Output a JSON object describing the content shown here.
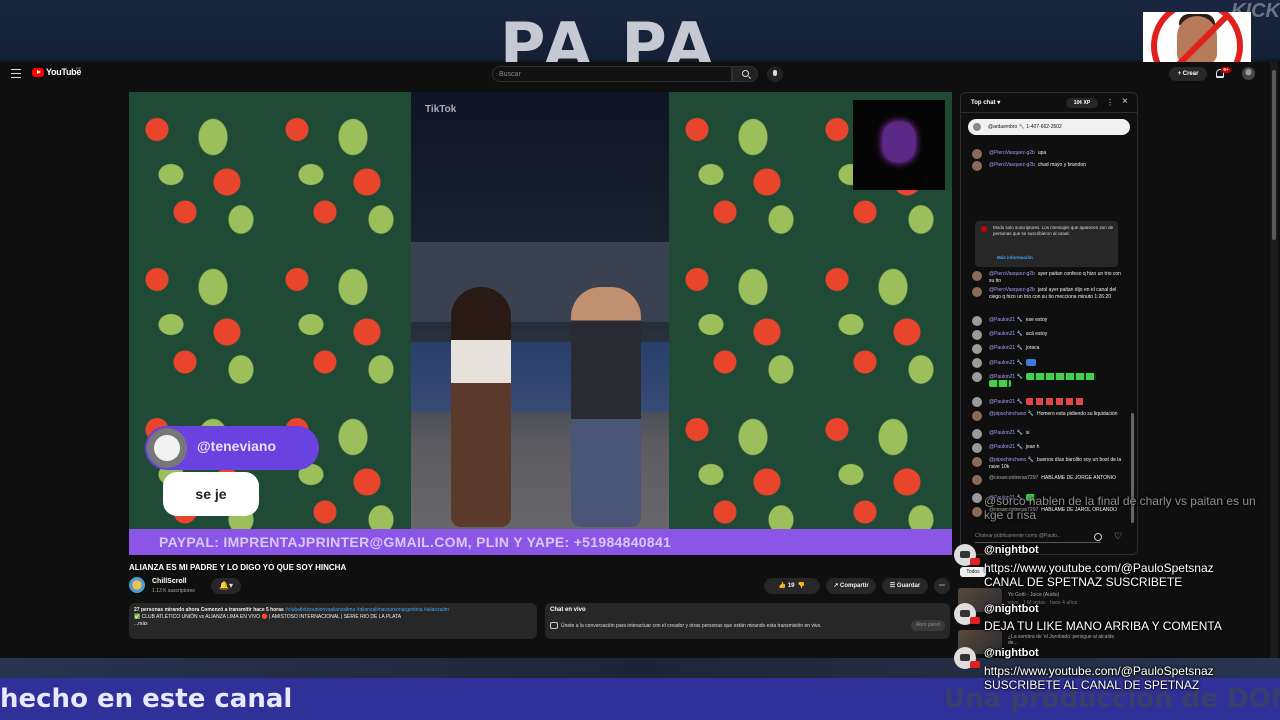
{
  "stream": {
    "title_text": "PA PA",
    "platform_mark": "KICK",
    "bottom_left_banner": "hecho en este canal",
    "bottom_right_banner": "Una produccion de DON M"
  },
  "youtube": {
    "wordmark": "YouTube",
    "country": "PE",
    "search_placeholder": "Buscar",
    "create_label": "+ Crear",
    "notifications_count": "9+"
  },
  "player": {
    "watermark": "TikTok",
    "alert_username": "@teneviano",
    "alert_message": "se je",
    "paypal_banner": "PAYPAL: IMPRENTAJPRINTER@GMAIL.COM, PLIN Y YAPE: +51984840841"
  },
  "video": {
    "title": "ALIANZA ES MI PADRE Y LO DIGO YO QUE SOY HINCHA",
    "channel_name": "ChillScroll",
    "channel_subs": "1.13 K suscriptores",
    "likes": "19",
    "share_label": "Compartir",
    "save_label": "Guardar",
    "description_meta": "27 personas mirando ahora  Comenzó a transmitir hace 5 horas",
    "description_tags": "#clubatleticounionvsalianzalima #alianzalimavsunionargentina #alianzalim",
    "description_body": "✅ CLUB ATLÉTICO UNIÓN vs ALIANZA LIMA EN VIVO 🔴 | AMISTOSO INTERNACIONAL | SERIE RIO DE LA PLATA",
    "description_more": "...más",
    "live_chat_title": "Chat en vivo",
    "live_chat_body": "Únete a la conversación para interactuar con el creador y otras personas que están mirando esta transmisión en vivo.",
    "join_label": "Abrir panel"
  },
  "chat": {
    "mode": "Top chat",
    "xp": "10¢ XP",
    "pinned": "@ardaembro 🔧   1-407-662-3502",
    "notice_text": "Modo solo suscriptores. Los mensajes que aparecen son de personas que se suscribieron al canal.",
    "notice_link": "Más información",
    "input_placeholder": "Chatear públicamente como @Paulo...",
    "messages": [
      {
        "author": "@PieroVasquez-g2b",
        "text": "upa"
      },
      {
        "author": "@PieroVasquez-g2b",
        "text": "chad mayo y brandon"
      },
      {
        "author": "@PieroVasquez-g2b",
        "text": "ayer paitan confeso q hizo un trio con su tio"
      },
      {
        "author": "@PieroVasquez-g2b",
        "text": "jarol ayer paitan dijo en el canal del ciego q hizo un trio con su tio mecciona minuto 1:26:20"
      },
      {
        "author": "@Paulon21 🔧",
        "text": "ese estoy"
      },
      {
        "author": "@Paulon21 🔧",
        "text": "acá estoy"
      },
      {
        "author": "@Paulon21 🔧",
        "text": "joraca"
      },
      {
        "author": "@Paulon21 🔧",
        "text": ""
      },
      {
        "author": "@Paulon21 🔧",
        "text": ""
      },
      {
        "author": "@Paulon21 🔧",
        "text": ""
      },
      {
        "author": "@pipochinchano 🔧",
        "text": "Homero esta pidiendo su liquidación"
      },
      {
        "author": "@Paulon21 🔧",
        "text": "si"
      },
      {
        "author": "@Paulon21 🔧",
        "text": "jean h"
      },
      {
        "author": "@pipochinchano 🔧",
        "text": "buenos días barolito soy un bost de la nave 10k"
      },
      {
        "author": "@cesarcontreras7297",
        "text": "HABLAME DE JORGE ANTONIO"
      },
      {
        "author": "@Paulon21 🔧",
        "text": ""
      },
      {
        "author": "@cesarcontreras7297",
        "text": "HABLAME DE JAROL ORLANDO"
      }
    ]
  },
  "recommended": {
    "chip_all": "Todos",
    "items": [
      {
        "title": "Yo Gotti - Juice (Audio)",
        "meta": "vevo · 1 M vistas · hace 4 años"
      },
      {
        "title": "¿La sombra de 'el Jorobado' persigue al alcalde de...",
        "meta": ""
      }
    ]
  },
  "overlay": {
    "faded_text": "@sorco  hablen de la final de charly vs paitan es un kge d risa",
    "messages": [
      {
        "author": "@nightbot",
        "lines": [
          "https://www.youtube.com/@PauloSpetsnaz",
          "CANAL DE SPETNAZ SUSCRIBETE"
        ]
      },
      {
        "author": "@nightbot",
        "lines": [
          "DEJA TU LIKE MANO ARRIBA Y COMENTA"
        ]
      },
      {
        "author": "@nightbot",
        "lines": [
          "https://www.youtube.com/@PauloSpetsnaz",
          "SUSCRIBETE AL CANAL DE SPETNAZ"
        ]
      }
    ]
  }
}
